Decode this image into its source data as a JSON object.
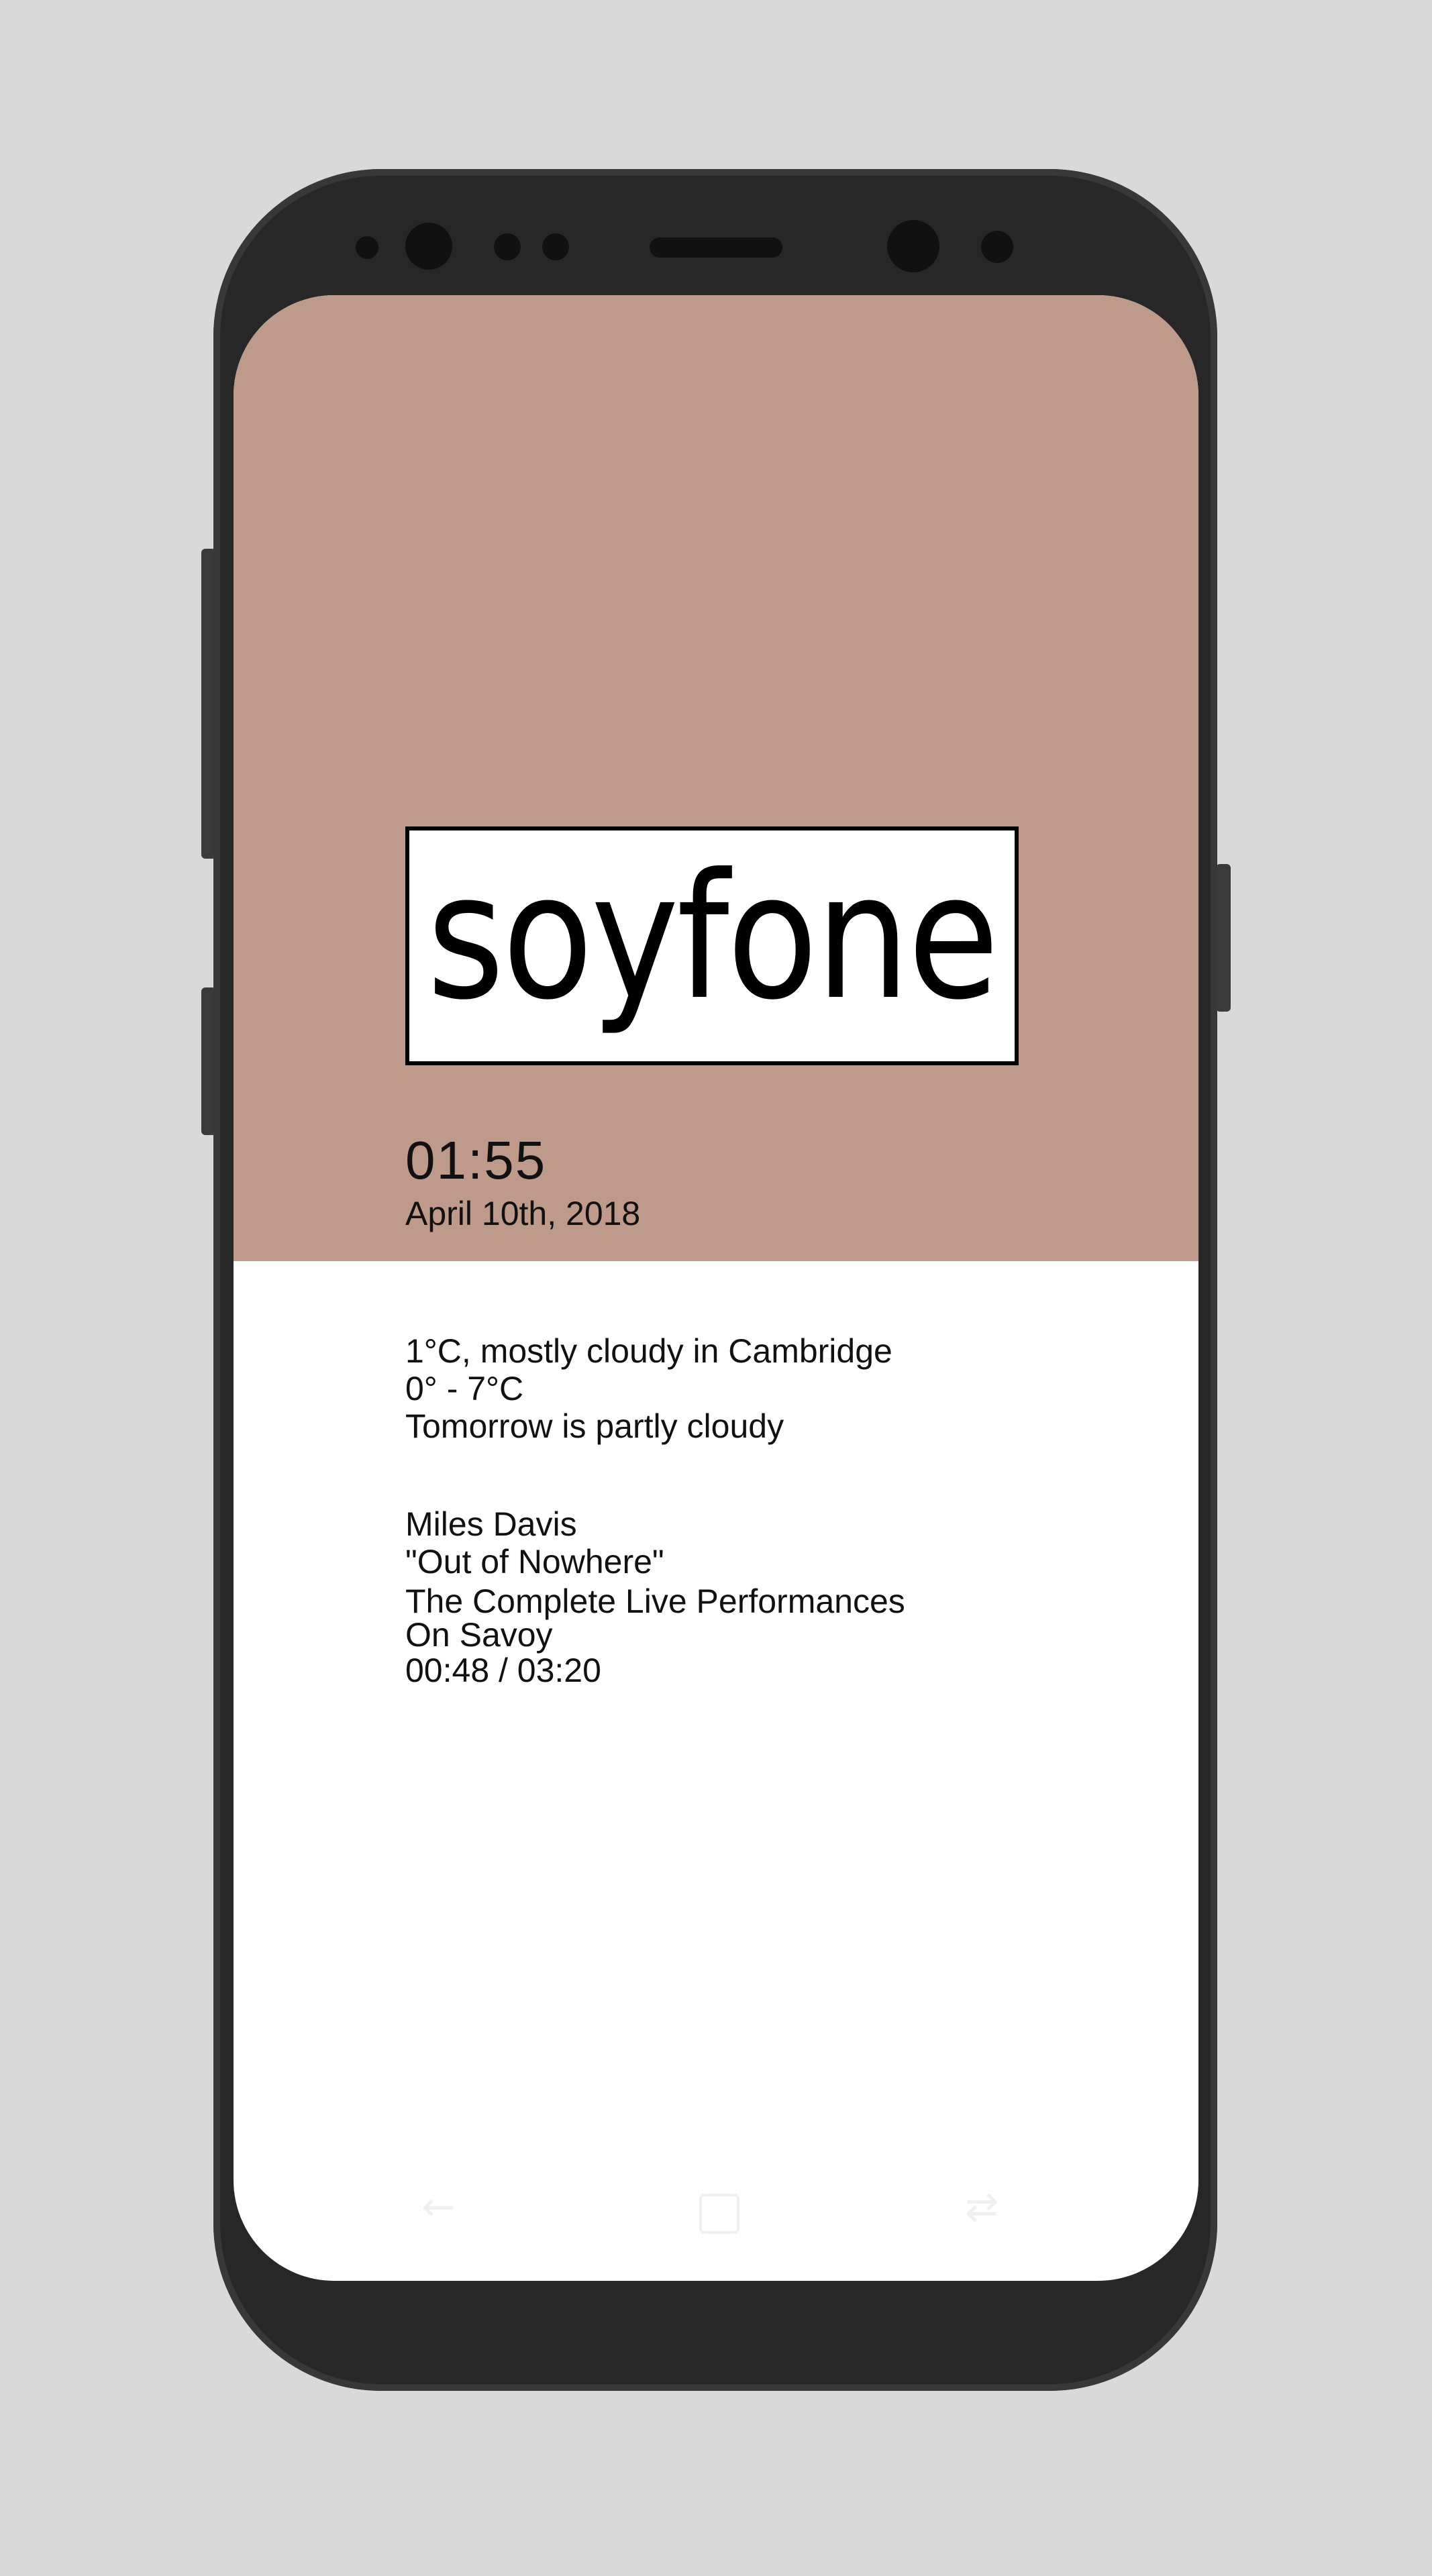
{
  "brand": {
    "logo_text": "soyfone"
  },
  "lockscreen": {
    "time": "01:55",
    "date": "April 10th, 2018"
  },
  "weather": {
    "current": "1°C, mostly cloudy in Cambridge",
    "range": "0° - 7°C",
    "forecast": "Tomorrow is partly cloudy"
  },
  "now_playing": {
    "artist": "Miles Davis",
    "track": "\"Out of Nowhere\"",
    "album_line1": "The Complete Live Performances",
    "album_line2": "On Savoy",
    "progress": "00:48 / 03:20",
    "progress_fraction": 0.24
  },
  "nav": {
    "back_icon": "back-arrow-icon",
    "home_icon": "home-square-icon",
    "recents_icon": "recents-icon"
  },
  "colors": {
    "accent_panel": "#bd9a89",
    "phone_body": "#272727",
    "background": "#d9d9d9"
  }
}
